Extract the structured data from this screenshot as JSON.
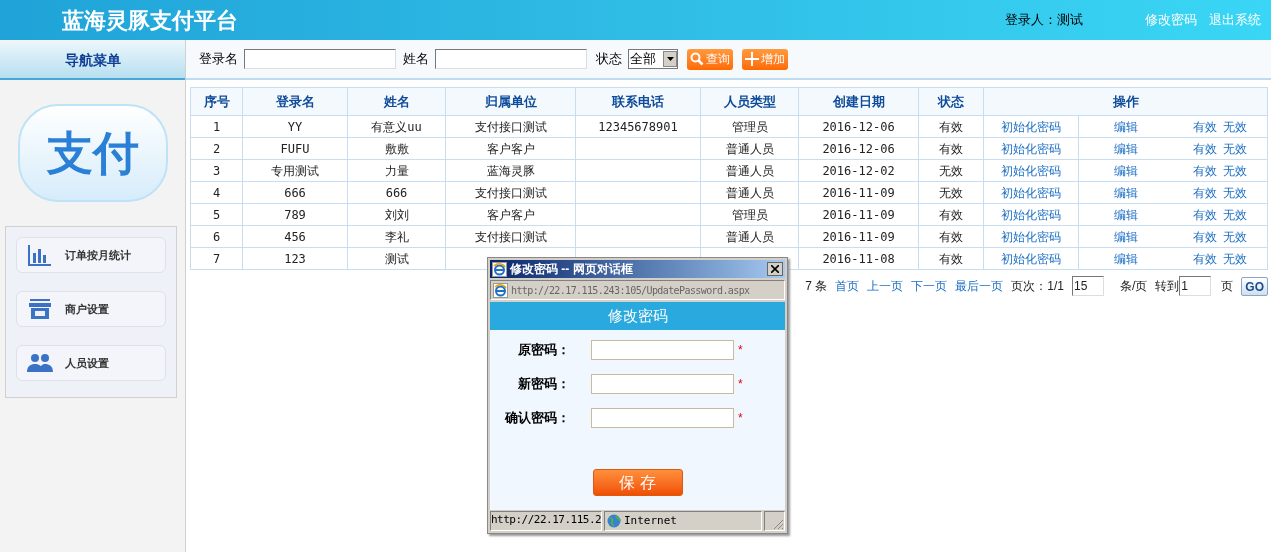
{
  "header": {
    "title": "蓝海灵豚支付平台",
    "user": "登录人：测试",
    "links": [
      "修改密码",
      "退出系统"
    ]
  },
  "sidebar": {
    "title": "导航菜单",
    "logo": "支付",
    "items": [
      {
        "label": "订单按月统计",
        "kind": "chart"
      },
      {
        "label": "商户设置",
        "kind": "store"
      },
      {
        "label": "人员设置",
        "kind": "people"
      }
    ]
  },
  "search": {
    "fields": [
      {
        "label": "登录名"
      },
      {
        "label": "姓名"
      }
    ],
    "status_label": "状态",
    "status_value": "全部",
    "buttons": [
      {
        "label": "查询",
        "kind": "search"
      },
      {
        "label": "增加",
        "kind": "add"
      }
    ]
  },
  "table": {
    "columns": [
      "序号",
      "登录名",
      "姓名",
      "归属单位",
      "联系电话",
      "人员类型",
      "创建日期",
      "状态",
      "操作"
    ],
    "rows": [
      {
        "cells": [
          "1",
          "YY",
          "有意义uu",
          "支付接口测试",
          "12345678901",
          "管理员",
          "2016-12-06",
          "有效"
        ],
        "actions": [
          "初始化密码",
          "编辑",
          "有效",
          "无效"
        ]
      },
      {
        "cells": [
          "2",
          "FUFU",
          "敷敷",
          "客户客户",
          "",
          "普通人员",
          "2016-12-06",
          "有效"
        ],
        "actions": [
          "初始化密码",
          "编辑",
          "有效",
          "无效"
        ]
      },
      {
        "cells": [
          "3",
          "专用测试",
          "力量",
          "蓝海灵豚",
          "",
          "普通人员",
          "2016-12-02",
          "无效"
        ],
        "actions": [
          "初始化密码",
          "编辑",
          "有效",
          "无效"
        ]
      },
      {
        "cells": [
          "4",
          "666",
          "666",
          "支付接口测试",
          "",
          "普通人员",
          "2016-11-09",
          "无效"
        ],
        "actions": [
          "初始化密码",
          "编辑",
          "有效",
          "无效"
        ]
      },
      {
        "cells": [
          "5",
          "789",
          "刘刘",
          "客户客户",
          "",
          "管理员",
          "2016-11-09",
          "有效"
        ],
        "actions": [
          "初始化密码",
          "编辑",
          "有效",
          "无效"
        ]
      },
      {
        "cells": [
          "6",
          "456",
          "李礼",
          "支付接口测试",
          "",
          "普通人员",
          "2016-11-09",
          "有效"
        ],
        "actions": [
          "初始化密码",
          "编辑",
          "有效",
          "无效"
        ]
      },
      {
        "cells": [
          "7",
          "123",
          "测试",
          "",
          "",
          "",
          "2016-11-08",
          "有效"
        ],
        "actions": [
          "初始化密码",
          "编辑",
          "有效",
          "无效"
        ]
      }
    ]
  },
  "pagination": {
    "count": "7 条",
    "links": [
      "首页",
      "上一页",
      "下一页",
      "最后一页"
    ],
    "page": "页次：1/1",
    "page_size": "15",
    "per_page": "条/页",
    "goto": "转到",
    "goto_value": "1",
    "page_unit": "页",
    "go": "GO"
  },
  "dialog": {
    "title": "修改密码 -- 网页对话框",
    "url": "http://22.17.115.243:105/UpdatePassword.aspx",
    "heading": "修改密码",
    "fields": [
      {
        "label": "原密码：",
        "mark": "*"
      },
      {
        "label": "新密码：",
        "mark": "*"
      },
      {
        "label": "确认密码：",
        "mark": "*"
      }
    ],
    "save": "保 存",
    "status_url": "http://22.17.115.2",
    "zone": "Internet"
  }
}
